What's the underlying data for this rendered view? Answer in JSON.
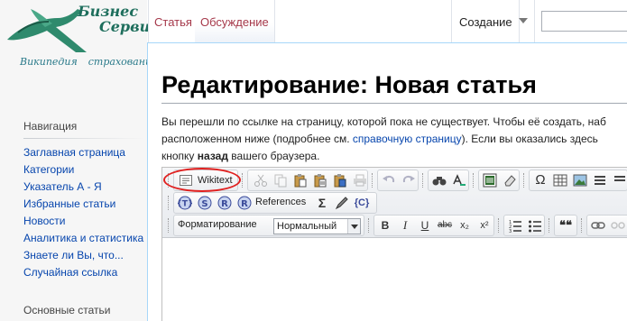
{
  "logo": {
    "title_line1": "Бизнес",
    "title_line2": "Сервис",
    "subtitle_word1": "Википедия",
    "subtitle_word2": "страхования"
  },
  "tabs": {
    "article": "Статья",
    "discussion": "Обсуждение",
    "create": "Создание"
  },
  "search": {
    "value": ""
  },
  "sidebar": {
    "navigation_heading": "Навигация",
    "items": [
      "Заглавная страница",
      "Категории",
      "Указатель А - Я",
      "Избранные статьи",
      "Новости",
      "Аналитика и статистика",
      "Знаете ли Вы, что...",
      "Случайная ссылка"
    ],
    "main_articles_heading": "Основные статьи"
  },
  "content": {
    "title": "Редактирование: Новая статья",
    "intro_line1": "Вы перешли по ссылке на страницу, которой пока не существует. Чтобы её создать, наб",
    "intro_line2_start": "расположенном ниже (подробнее см. ",
    "intro_link": "справочную страницу",
    "intro_line2_end": "). Если вы оказались здесь",
    "intro_line3_start": "кнопку ",
    "intro_bold": "назад",
    "intro_line3_end": " вашего браузера."
  },
  "editor": {
    "wikitext_label": "Wikitext",
    "references_label": "References",
    "formatting_label": "Форматирование",
    "format_value": "Нормальный",
    "sigma_glyph": "Σ",
    "bold_glyph": "B",
    "italic_glyph": "I",
    "underline_glyph": "U",
    "strike_glyph": "abc",
    "subscript_glyph": "x₂",
    "superscript_glyph": "x²",
    "quote_glyph": "❝❝",
    "omega_glyph": "Ω",
    "ref_braces": "{C}"
  },
  "colors": {
    "link": "#0645ad",
    "tab_text": "#a5384a",
    "highlight_ellipse": "#e0201f",
    "content_border": "#a7d7f9",
    "logo_green": "#1e6e5c"
  }
}
